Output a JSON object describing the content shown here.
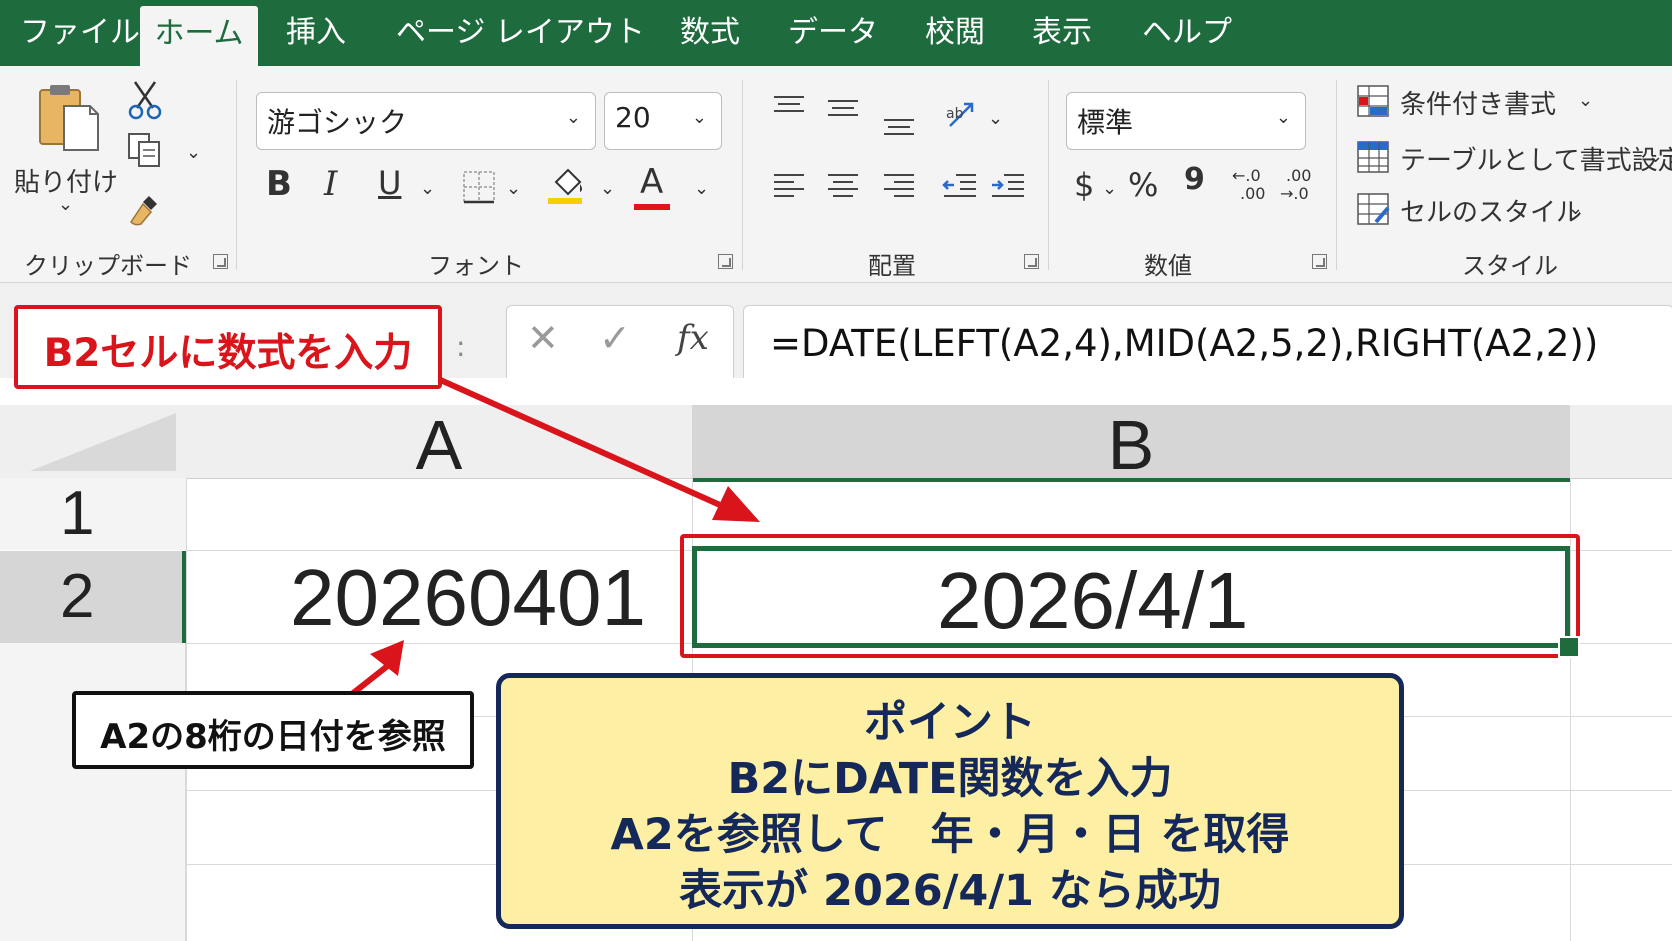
{
  "tabs": [
    "ファイル",
    "ホーム",
    "挿入",
    "ページ レイアウト",
    "数式",
    "データ",
    "校閲",
    "表示",
    "ヘルプ"
  ],
  "active_tab": "ホーム",
  "ribbon": {
    "clipboard": {
      "paste_label": "貼り付け",
      "group_label": "クリップボード"
    },
    "font": {
      "font_name": "游ゴシック",
      "font_size": "20",
      "bold": "B",
      "italic": "I",
      "underline": "U",
      "font_color_glyph": "A",
      "group_label": "フォント"
    },
    "alignment": {
      "group_label": "配置"
    },
    "number": {
      "format": "標準",
      "currency": "$",
      "percent": "%",
      "comma": "9",
      "inc_top": "←.0",
      "inc_bottom": ".00",
      "dec_top": ".00",
      "dec_bottom": "→.0",
      "group_label": "数値"
    },
    "styles": {
      "conditional": "条件付き書式",
      "table": "テーブルとして書式設定",
      "cell_styles": "セルのスタイル",
      "group_label": "スタイル"
    }
  },
  "formula_bar": {
    "name_box_dots": ":",
    "cancel_glyph": "✕",
    "enter_glyph": "✓",
    "fx_label": "fx",
    "formula": "=DATE(LEFT(A2,4),MID(A2,5,2),RIGHT(A2,2))"
  },
  "grid": {
    "columns": [
      "A",
      "B"
    ],
    "rows": [
      "1",
      "2"
    ],
    "cells": {
      "A2": "20260401",
      "B2": "2026/4/1"
    }
  },
  "annotations": {
    "callout_formula": "B2セルに数式を入力",
    "callout_ref": "A2の8桁の日付を参照",
    "point_lines": [
      "ポイント",
      "B2にDATE関数を入力",
      "A2を参照して　年・月・日 を取得",
      "表示が 2026/4/1 なら成功"
    ]
  },
  "colors": {
    "excel_green": "#1e6b3e",
    "annotation_red": "#d9151b",
    "point_bg": "#fdf0a4",
    "point_border": "#14285a"
  }
}
